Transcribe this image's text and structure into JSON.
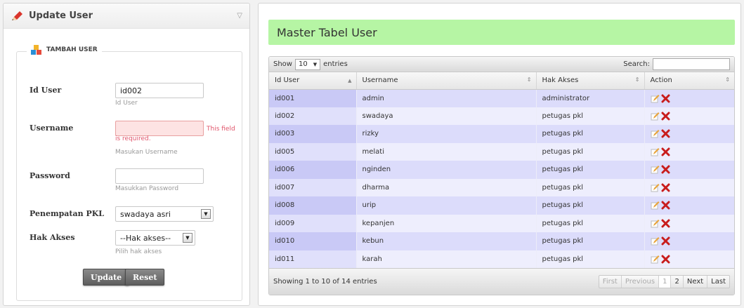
{
  "form": {
    "title": "Update User",
    "legend": "TAMBAH USER",
    "fields": {
      "id_user": {
        "label": "Id User",
        "value": "id002",
        "help": "Id User"
      },
      "username": {
        "label": "Username",
        "value": "",
        "error": "This field is required.",
        "help": "Masukan Username"
      },
      "password": {
        "label": "Password",
        "value": "",
        "help": "Masukkan Password"
      },
      "penempatan": {
        "label": "Penempatan PKL",
        "selected": "swadaya asri"
      },
      "hak_akses": {
        "label": "Hak Akses",
        "selected": "--Hak akses--",
        "help": "Pilih hak akses"
      }
    },
    "buttons": {
      "update": "Update",
      "reset": "Reset"
    }
  },
  "table": {
    "title": "Master Tabel User",
    "show_label": "Show",
    "length_value": "10",
    "entries_label": "entries",
    "search_label": "Search:",
    "columns": [
      "Id User",
      "Username",
      "Hak Akses",
      "Action"
    ],
    "rows": [
      {
        "id": "id001",
        "username": "admin",
        "hak_akses": "administrator"
      },
      {
        "id": "id002",
        "username": "swadaya",
        "hak_akses": "petugas pkl"
      },
      {
        "id": "id003",
        "username": "rizky",
        "hak_akses": "petugas pkl"
      },
      {
        "id": "id005",
        "username": "melati",
        "hak_akses": "petugas pkl"
      },
      {
        "id": "id006",
        "username": "nginden",
        "hak_akses": "petugas pkl"
      },
      {
        "id": "id007",
        "username": "dharma",
        "hak_akses": "petugas pkl"
      },
      {
        "id": "id008",
        "username": "urip",
        "hak_akses": "petugas pkl"
      },
      {
        "id": "id009",
        "username": "kepanjen",
        "hak_akses": "petugas pkl"
      },
      {
        "id": "id010",
        "username": "kebun",
        "hak_akses": "petugas pkl"
      },
      {
        "id": "id011",
        "username": "karah",
        "hak_akses": "petugas pkl"
      }
    ],
    "info": "Showing 1 to 10 of 14 entries",
    "pager": {
      "first": "First",
      "previous": "Previous",
      "page1": "1",
      "page2": "2",
      "next": "Next",
      "last": "Last"
    }
  },
  "colors": {
    "title_bg": "#b6f5a4",
    "row_odd": "#dcdcfb",
    "row_even": "#eeeefd",
    "error_bg": "#fde3e3",
    "delete_icon": "#c81c1c",
    "edit_icon": "#e8a33a"
  },
  "icons": {
    "header": "pencil-icon",
    "legend": "blocks-icon",
    "edit": "edit-icon",
    "delete": "delete-icon"
  }
}
